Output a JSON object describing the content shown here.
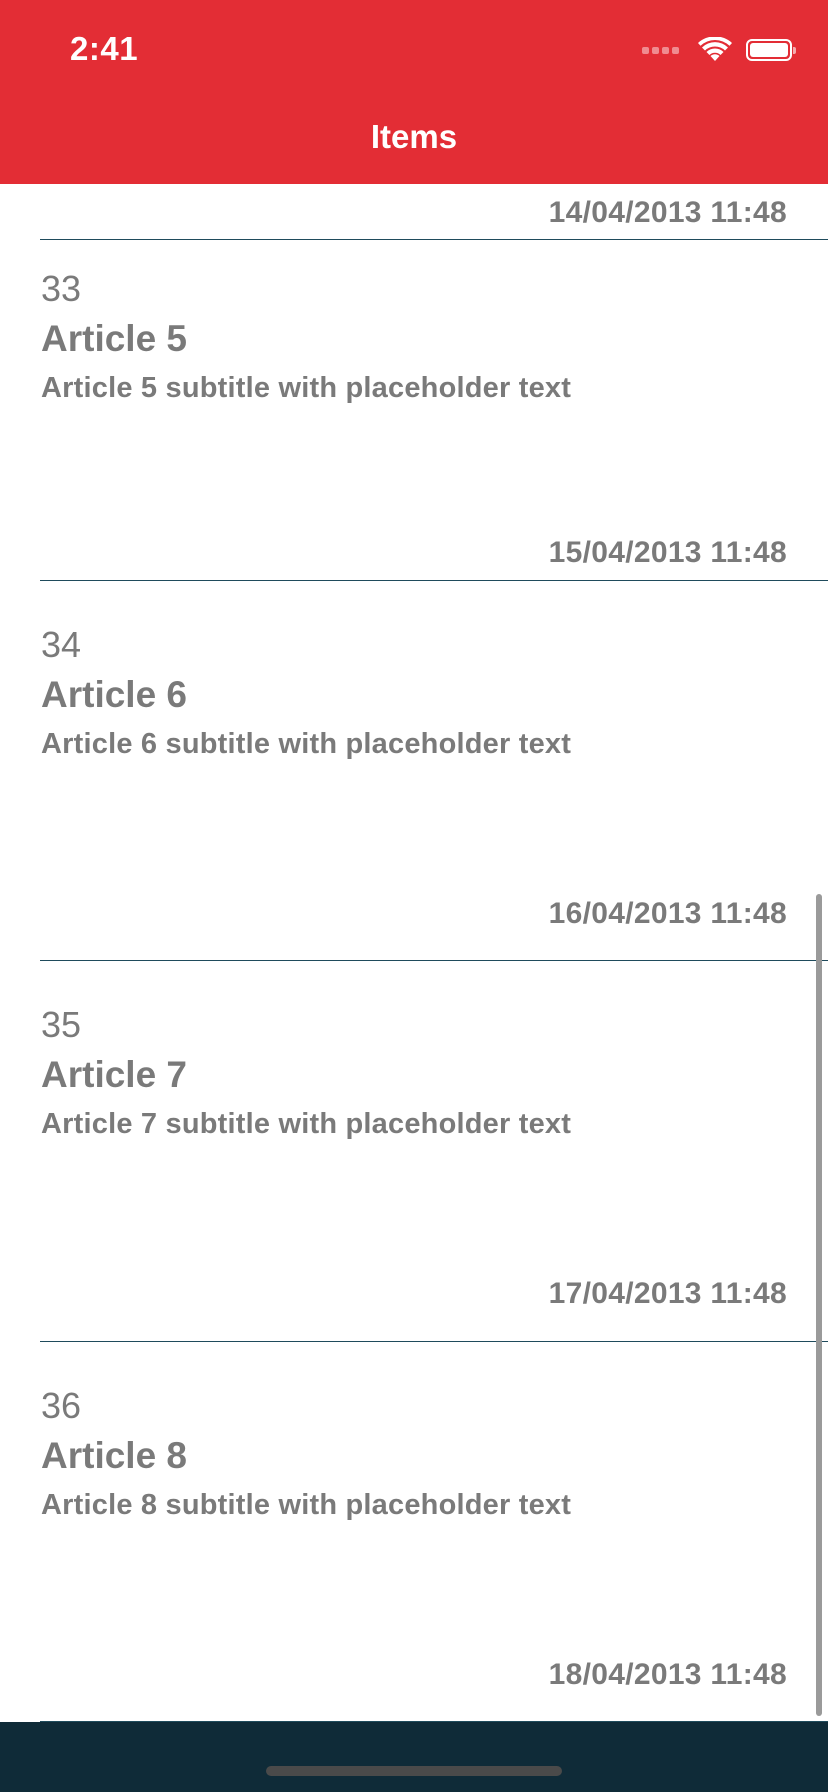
{
  "status_bar": {
    "time": "2:41",
    "signal_icon": "cellular-signal-icon",
    "wifi_icon": "wifi-icon",
    "battery_icon": "battery-icon"
  },
  "nav": {
    "title": "Items"
  },
  "colors": {
    "header": "#e32d35",
    "bottom_bar": "#0f2b38",
    "text": "#7a7a7a",
    "divider": "#1f4b5c"
  },
  "list": {
    "top_date": "14/04/2013 11:48",
    "items": [
      {
        "number": "33",
        "title": "Article 5",
        "subtitle": "Article 5 subtitle with placeholder text",
        "date": "15/04/2013 11:48"
      },
      {
        "number": "34",
        "title": "Article 6",
        "subtitle": "Article 6 subtitle with placeholder text",
        "date": "16/04/2013 11:48"
      },
      {
        "number": "35",
        "title": "Article 7",
        "subtitle": "Article 7 subtitle with placeholder text",
        "date": "17/04/2013 11:48"
      },
      {
        "number": "36",
        "title": "Article 8",
        "subtitle": "Article 8 subtitle with placeholder text",
        "date": "18/04/2013 11:48"
      }
    ]
  }
}
